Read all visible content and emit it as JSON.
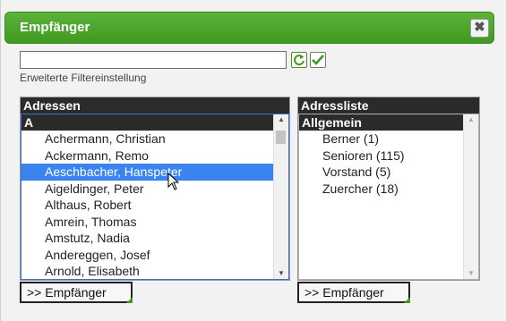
{
  "dialog": {
    "title": "Empfänger",
    "close_glyph": "✖",
    "accent": "#4aa52b"
  },
  "filter": {
    "value": "",
    "placeholder": "",
    "hint": "Erweiterte Filtereinstellung",
    "icons": [
      "refresh-icon",
      "checkmark-icon"
    ]
  },
  "left_panel": {
    "header": "Adressen",
    "group": "A",
    "items": [
      {
        "label": "Achermann, Christian",
        "selected": false
      },
      {
        "label": "Ackermann, Remo",
        "selected": false
      },
      {
        "label": "Aeschbacher, Hanspeter",
        "selected": true
      },
      {
        "label": "Aigeldinger, Peter",
        "selected": false
      },
      {
        "label": "Althaus, Robert",
        "selected": false
      },
      {
        "label": "Amrein, Thomas",
        "selected": false
      },
      {
        "label": "Amstutz, Nadia",
        "selected": false
      },
      {
        "label": "Andereggen, Josef",
        "selected": false
      },
      {
        "label": "Arnold, Elisabeth",
        "selected": false
      }
    ],
    "button": ">> Empfänger"
  },
  "right_panel": {
    "header": "Adressliste",
    "group": "Allgemein",
    "items": [
      {
        "label": "Berner (1)"
      },
      {
        "label": "Senioren (115)"
      },
      {
        "label": "Vorstand (5)"
      },
      {
        "label": "Zuercher (18)"
      }
    ],
    "button": ">> Empfänger"
  }
}
